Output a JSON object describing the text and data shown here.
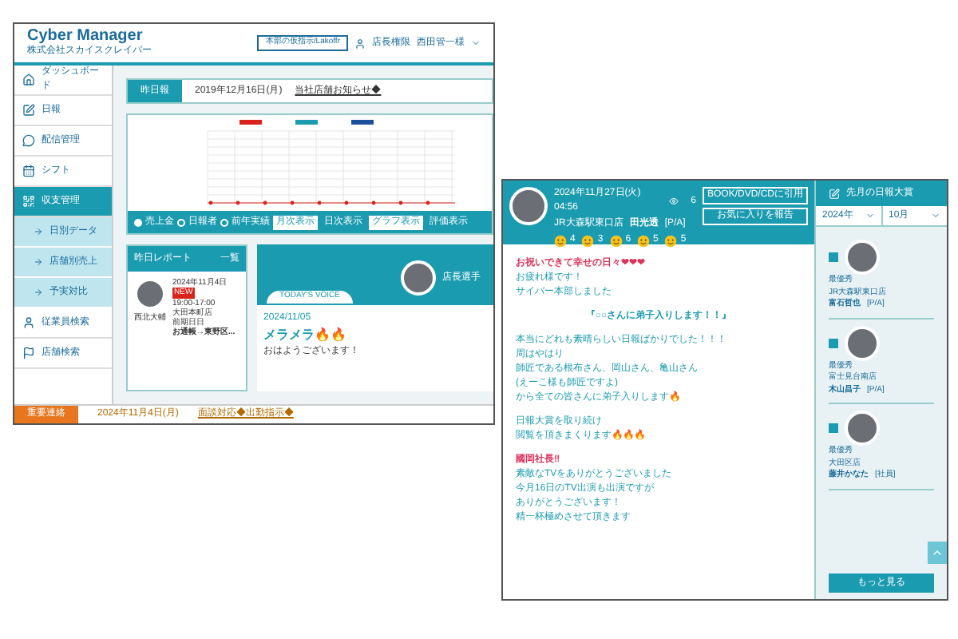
{
  "app": {
    "title": "Cyber Manager",
    "company": "株式会社スカイスクレイパー",
    "header_button": "本部の仮指示/Lakoffr",
    "role": "店長権限",
    "user": "西田管一様"
  },
  "sidebar": {
    "items": [
      {
        "label": "ダッシュボード",
        "selected": false
      },
      {
        "label": "日報",
        "selected": false
      },
      {
        "label": "配信管理",
        "selected": false
      },
      {
        "label": "シフト",
        "selected": false
      },
      {
        "label": "収支管理",
        "selected": true,
        "children": [
          {
            "label": "日別データ"
          },
          {
            "label": "店舗別売上"
          },
          {
            "label": "予実対比"
          }
        ]
      },
      {
        "label": "従業員検索",
        "selected": false
      },
      {
        "label": "店舗検索",
        "selected": false
      }
    ]
  },
  "notice": {
    "label": "昨日報",
    "date": "2019年12月16日(月)",
    "link": "当社店舗お知らせ◆"
  },
  "toolbar": {
    "radios": [
      {
        "label": "売上金",
        "selected": true
      },
      {
        "label": "日報者",
        "selected": false
      },
      {
        "label": "前年実績",
        "selected": false
      }
    ],
    "buttons": [
      {
        "label": "月次表示",
        "selected": true
      },
      {
        "label": "日次表示",
        "selected": false
      },
      {
        "label": "グラフ表示",
        "selected": true
      },
      {
        "label": "評価表示",
        "selected": false
      }
    ]
  },
  "report": {
    "title": "昨日レポート",
    "more": "一覧",
    "name": "西北大輔",
    "date": "2024年11月4日",
    "badge": "NEW",
    "time": "19:00-17:00",
    "store": "大田本町店",
    "note": "前期日日",
    "summary": "お通帳→東野区..."
  },
  "voice": {
    "tag": "TODAY'S VOICE",
    "person": "店長選手",
    "date": "2024/11/05",
    "title": "メラメラ🔥🔥",
    "text": "おはようございます！"
  },
  "footer": {
    "label": "重要連絡",
    "date": "2024年11月4日(月)",
    "link": "面談対応◆出勤指示◆"
  },
  "post": {
    "datetime": "2024年11月27日(火) 04:56",
    "views": "6",
    "store": "JR大森駅東口店",
    "name": "田光透",
    "role": "[P/A]",
    "reactions": [
      "4",
      "3",
      "6",
      "5",
      "5"
    ],
    "buttons": [
      "BOOK/DVD/CDに引用",
      "お気に入りを報告"
    ],
    "paragraphs": [
      [
        {
          "kind": "title",
          "text": "お祝いできて幸せの日々❤❤❤"
        },
        {
          "kind": "text",
          "text": "お疲れ様です！"
        },
        {
          "kind": "text",
          "text": "サイバー本部しました"
        }
      ],
      [
        {
          "kind": "center",
          "text": "『○○さんに弟子入りします！！』"
        }
      ],
      [
        {
          "kind": "text",
          "text": "本当にどれも素晴らしい日報ばかりでした！！！"
        },
        {
          "kind": "text",
          "text": "周はやはり"
        },
        {
          "kind": "text",
          "text": "師匠である根布さん、岡山さん、亀山さん"
        },
        {
          "kind": "text",
          "text": "(えーこ様も師匠ですよ)"
        },
        {
          "kind": "text",
          "text": "から全ての皆さんに弟子入りします🔥"
        }
      ],
      [
        {
          "kind": "text",
          "text": "日報大賞を取り続け"
        },
        {
          "kind": "text",
          "text": "閲覧を頂きまくります🔥🔥🔥"
        }
      ],
      [
        {
          "kind": "title",
          "text": "國岡社長‼"
        },
        {
          "kind": "text",
          "text": "素敵なTVをありがとうございました"
        },
        {
          "kind": "text",
          "text": "今月16日のTV出演も出演ですが"
        },
        {
          "kind": "text",
          "text": "ありがとうございます！"
        },
        {
          "kind": "text",
          "text": "精一杯極めさせて頂きます"
        }
      ]
    ]
  },
  "awards": {
    "title": "先月の日報大賞",
    "year": "2024年",
    "month": "10月",
    "more": "もっと見る",
    "entries": [
      {
        "rank": "最優秀",
        "store": "JR大森駅東口店",
        "name": "富石哲也",
        "role": "[P/A]"
      },
      {
        "rank": "最優秀",
        "store": "富士見台南店",
        "name": "木山昌子",
        "role": "[P/A]"
      },
      {
        "rank": "最優秀",
        "store": "大田区店",
        "name": "藤井かなた",
        "role": "[社員]"
      }
    ]
  }
}
